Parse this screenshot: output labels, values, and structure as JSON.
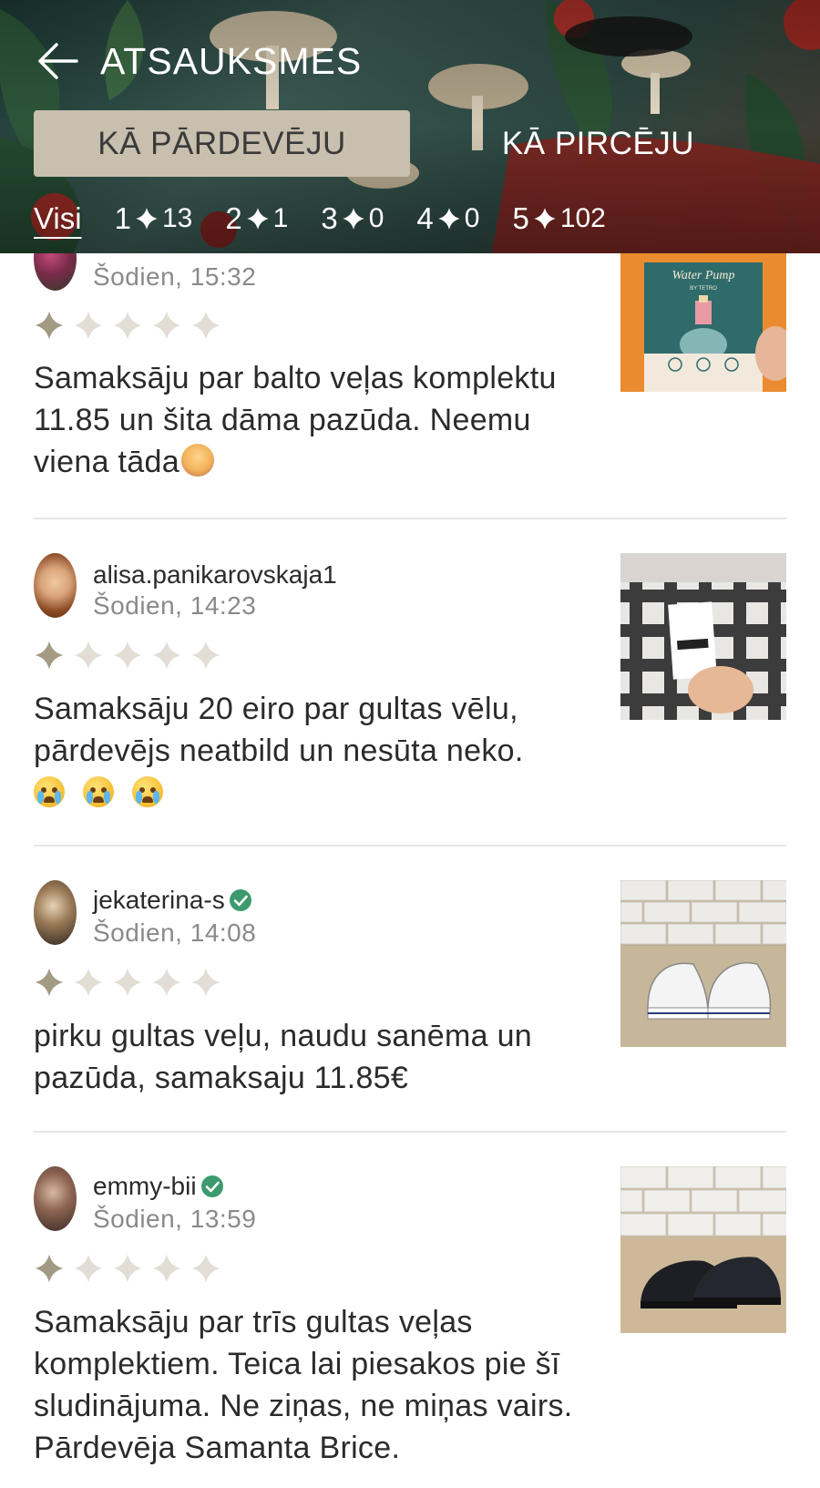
{
  "header": {
    "title": "ATSAUKSMES",
    "back_icon": "arrow-left-icon",
    "segments": {
      "active": "KĀ PĀRDEVĒJU",
      "inactive": "KĀ PIRCĒJU"
    },
    "filters": {
      "all": "Visi",
      "items": [
        {
          "stars": "1",
          "count": "13"
        },
        {
          "stars": "2",
          "count": "1"
        },
        {
          "stars": "3",
          "count": "0"
        },
        {
          "stars": "4",
          "count": "0"
        },
        {
          "stars": "5",
          "count": "102"
        }
      ]
    }
  },
  "colors": {
    "star_active": "#a39a84",
    "star_inactive": "#e2ded5",
    "verified": "#3d9a6d",
    "segment_active": "#c8bfae"
  },
  "reviews": [
    {
      "username": "",
      "time": "Šodien, 15:32",
      "rating": 1,
      "text": "Samaksāju par balto veļas komplektu 11.85 un šita dāma pazūda. Neemu viena tāda",
      "emoji": "facepalm",
      "photo_label": "Water Pump",
      "photo_sub": "BY TETRO",
      "verified": false
    },
    {
      "username": "alisa.panikarovskaja1",
      "time": "Šodien, 14:23",
      "rating": 1,
      "text": "Samaksāju 20 eiro par gultas vēlu, pārdevējs neatbild un nesūta neko.",
      "emoji": "crying",
      "verified": false
    },
    {
      "username": "jekaterina-s",
      "time": "Šodien, 14:08",
      "rating": 1,
      "text": "pirku gultas veļu, naudu sanēma un pazūda, samaksaju 11.85€",
      "verified": true
    },
    {
      "username": "emmy-bii",
      "time": "Šodien, 13:59",
      "rating": 1,
      "text": "Samaksāju par trīs gultas veļas komplektiem. Teica lai piesakos pie šī sludinājuma. Ne ziņas, ne miņas vairs. Pārdevēja Samanta Brice.",
      "verified": true
    }
  ]
}
